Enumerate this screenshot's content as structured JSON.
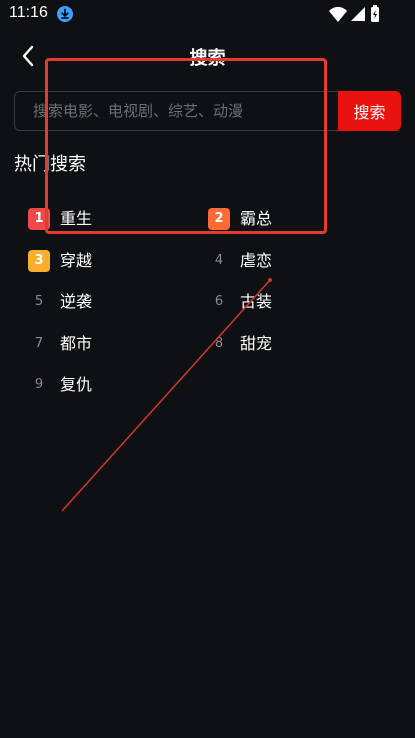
{
  "status_bar": {
    "time": "11:16",
    "icons": [
      "download-icon",
      "wifi-icon",
      "signal-icon",
      "battery-icon"
    ]
  },
  "header": {
    "title": "搜索"
  },
  "search": {
    "placeholder": "搜索电影、电视剧、综艺、动漫",
    "value": "",
    "button_label": "搜索"
  },
  "hot": {
    "title": "热门搜索",
    "items": [
      {
        "rank": "1",
        "label": "重生"
      },
      {
        "rank": "2",
        "label": "霸总"
      },
      {
        "rank": "3",
        "label": "穿越"
      },
      {
        "rank": "4",
        "label": "虐恋"
      },
      {
        "rank": "5",
        "label": "逆袭"
      },
      {
        "rank": "6",
        "label": "古装"
      },
      {
        "rank": "7",
        "label": "都市"
      },
      {
        "rank": "8",
        "label": "甜宠"
      },
      {
        "rank": "9",
        "label": "复仇"
      }
    ]
  },
  "colors": {
    "background": "#0f1013",
    "accent": "#e8130f",
    "rank1": "#f04a4a",
    "rank2": "#ff6a35",
    "rank3": "#f8b02c",
    "annotation": "#e53b2e"
  }
}
